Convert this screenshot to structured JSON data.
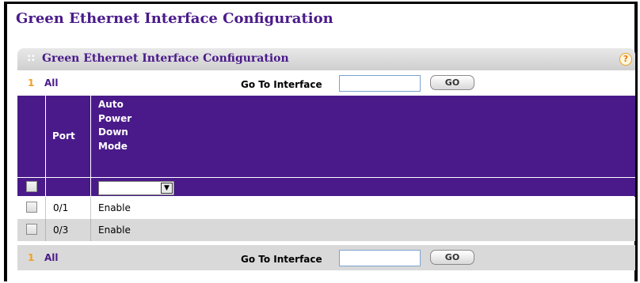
{
  "page": {
    "title": "Green Ethernet Interface Configuration"
  },
  "panel": {
    "title": "Green Ethernet Interface Configuration",
    "help_icon": "?"
  },
  "nav": {
    "page_number": "1",
    "all_label": "All",
    "goto_label": "Go To Interface",
    "goto_value": "",
    "go_label": "GO"
  },
  "table": {
    "columns": [
      "",
      "Port",
      "Auto Power Down Mode"
    ],
    "header_mode_lines": [
      "Auto",
      "Power",
      "Down",
      "Mode"
    ],
    "filter": {
      "mode_selected": ""
    },
    "rows": [
      {
        "port": "0/1",
        "mode": "Enable"
      },
      {
        "port": "0/3",
        "mode": "Enable"
      }
    ]
  },
  "colors": {
    "header_purple": "#4a1a8a",
    "accent_orange": "#f0a020",
    "row_alt": "#d9d9d9"
  }
}
